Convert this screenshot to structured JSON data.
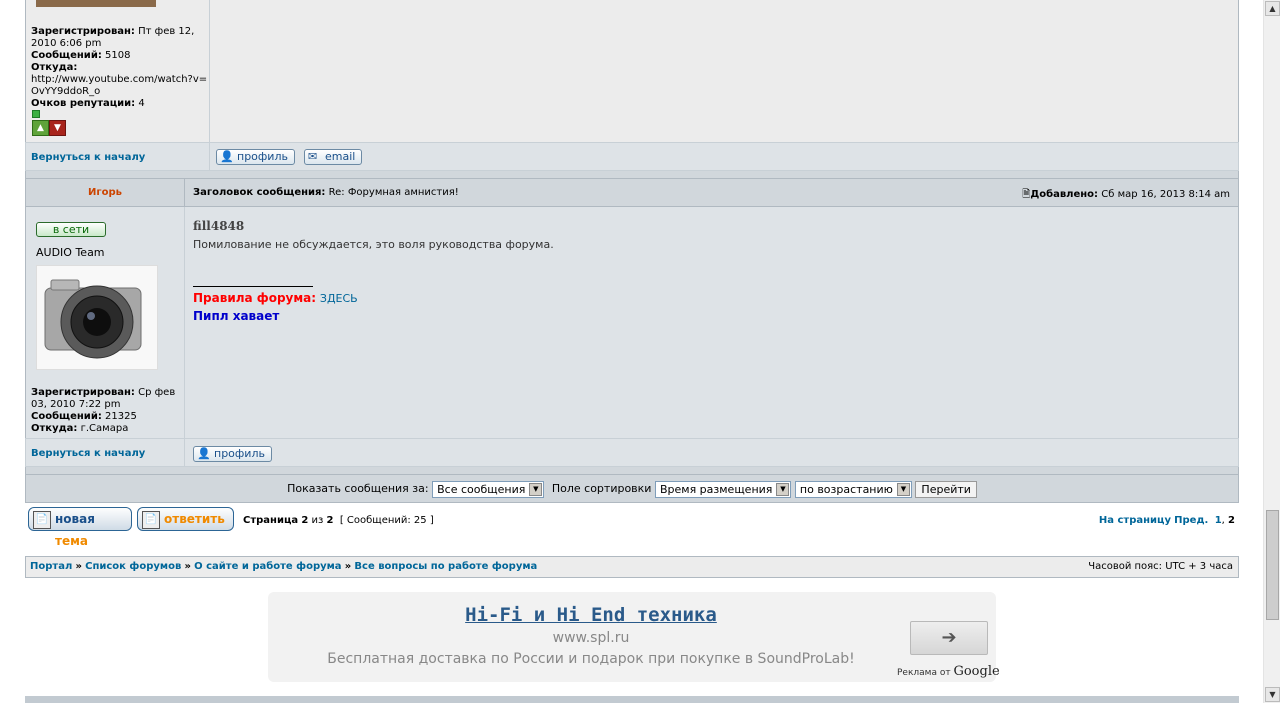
{
  "post1": {
    "registered_label": "Зарегистрирован:",
    "registered_value": "Пт фев 12, 2010 6:06 pm",
    "posts_label": "Сообщений:",
    "posts_value": "5108",
    "from_label": "Откуда:",
    "from_value": "http://www.youtube.com/watch?v=OvYY9ddoR_o",
    "rep_label": "Очков репутации:",
    "rep_value": "4",
    "back_to_top": "Вернуться к началу",
    "profile_btn": "профиль",
    "email_btn": "email"
  },
  "post2": {
    "author": "Игорь",
    "subject_label": "Заголовок сообщения:",
    "subject_value": "Re: Форумная амнистия!",
    "posted_label": "Добавлено:",
    "posted_value": "Сб мар 16, 2013 8:14 am",
    "online_badge": "в сети",
    "rank": "AUDIO Team",
    "quote_author": "fill4848",
    "body": "Помилование не обсуждается, это воля руководства форума.",
    "signature_rules_label": "Правила форума:",
    "signature_rules_link": "ЗДЕСЬ",
    "signature_line2": "Пипл хавает",
    "registered_label": "Зарегистрирован:",
    "registered_value": "Ср фев 03, 2010 7:22 pm",
    "posts_label": "Сообщений:",
    "posts_value": "21325",
    "from_label": "Откуда:",
    "from_value": "г.Самара",
    "back_to_top": "Вернуться к началу",
    "profile_btn": "профиль"
  },
  "filter": {
    "show_label": "Показать сообщения за:",
    "show_value": "Все сообщения",
    "sort_label": "Поле сортировки",
    "sort_value": "Время размещения",
    "order_value": "по возрастанию",
    "go_btn": "Перейти"
  },
  "actions": {
    "new_topic_1": "новая",
    "new_topic_2": "тема",
    "reply": "ответить",
    "page_prefix": "Страница",
    "page_current": "2",
    "page_of": "из",
    "page_total": "2",
    "messages": "[ Сообщений: 25 ]",
    "goto_label": "На страницу",
    "prev": "Пред.",
    "page1": "1",
    "page2": "2"
  },
  "breadcrumb": {
    "portal": "Портал",
    "forums": "Список форумов",
    "about": "О сайте и работе форума",
    "questions": "Все вопросы по работе форума",
    "timezone": "Часовой пояс: UTC + 3 часа",
    "sep": "»"
  },
  "ad": {
    "title": "Hi-Fi и Hi End техника",
    "url": "www.spl.ru",
    "text": "Бесплатная доставка по России и подарок при покупке в SoundProLab!",
    "ads_by": "Реклама от",
    "google": "Google"
  },
  "colors": {
    "link": "#006699",
    "author": "#cc4400",
    "rules_red": "#ff0000",
    "signature_blue": "#0000cc"
  }
}
